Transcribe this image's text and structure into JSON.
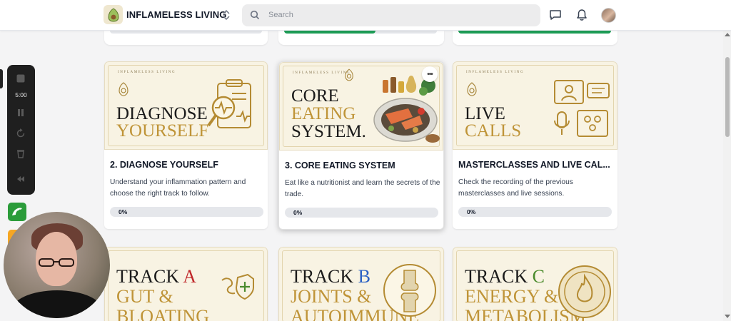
{
  "header": {
    "brand": "INFLAMELESS LIVING",
    "search_placeholder": "Search"
  },
  "colors": {
    "accent_green": "#1e9e57",
    "gold": "#bf9438",
    "cream": "#f8f3e3"
  },
  "cards_row1": [
    {
      "mini_brand": "INFLAMELESS LIVING",
      "thumb_line1": "DIAGNOSE",
      "thumb_line2": "YOURSELF",
      "title": "2. DIAGNOSE YOURSELF",
      "description": "Understand your inflammation pattern and choose the right track to follow.",
      "progress": "0%",
      "progress_value": 0
    },
    {
      "mini_brand": "INFLAMELESS LIVING",
      "thumb_line1": "CORE",
      "thumb_line2": "EATING",
      "thumb_line3": "SYSTEM.",
      "title": "3. CORE EATING SYSTEM",
      "description": "Eat like a nutritionist and learn the secrets of the trade.",
      "progress": "0%",
      "progress_value": 0
    },
    {
      "mini_brand": "INFLAMELESS LIVING",
      "thumb_line1": "LIVE",
      "thumb_line2": "CALLS",
      "title": "MASTERCLASSES AND LIVE CAL...",
      "description": "Check the recording of the previous masterclasses and live sessions.",
      "progress": "0%",
      "progress_value": 0
    }
  ],
  "cards_row2": [
    {
      "track_word": "TRACK",
      "track_letter": "A",
      "line2": "GUT &",
      "line3": "BLOATING"
    },
    {
      "track_word": "TRACK",
      "track_letter": "B",
      "line2": "JOINTS &",
      "line3": "AUTOIMMUNE"
    },
    {
      "track_word": "TRACK",
      "track_letter": "C",
      "line2": "ENERGY &",
      "line3": "METABOLISM"
    }
  ],
  "recorder": {
    "time": "5:00"
  }
}
